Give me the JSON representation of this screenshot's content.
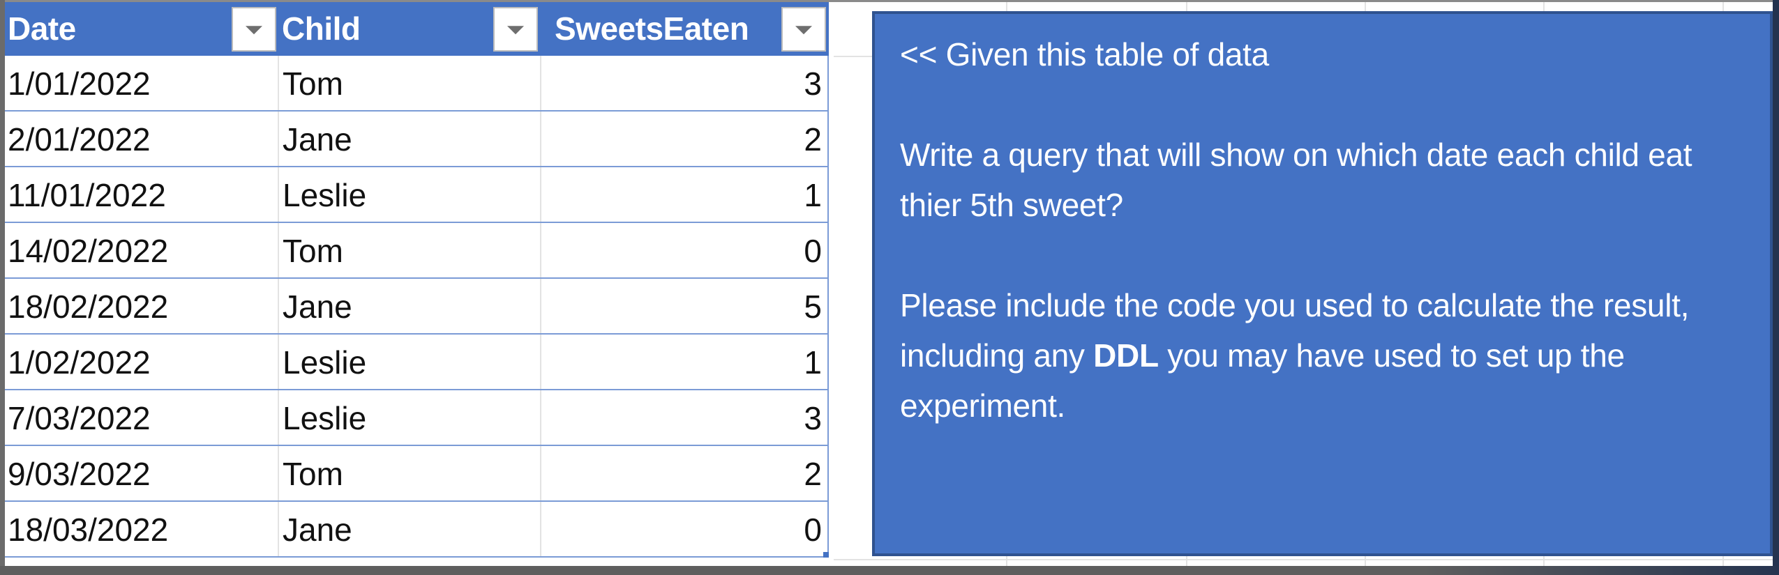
{
  "table": {
    "columns": [
      {
        "label": "Date",
        "filter_icon": "filter-dropdown-icon"
      },
      {
        "label": "Child",
        "filter_icon": "filter-dropdown-icon"
      },
      {
        "label": "SweetsEaten",
        "filter_icon": "filter-dropdown-icon"
      }
    ],
    "rows": [
      {
        "date": "1/01/2022",
        "child": "Tom",
        "sweets": "3"
      },
      {
        "date": "2/01/2022",
        "child": "Jane",
        "sweets": "2"
      },
      {
        "date": "11/01/2022",
        "child": "Leslie",
        "sweets": "1"
      },
      {
        "date": "14/02/2022",
        "child": "Tom",
        "sweets": "0"
      },
      {
        "date": "18/02/2022",
        "child": "Jane",
        "sweets": "5"
      },
      {
        "date": "1/02/2022",
        "child": "Leslie",
        "sweets": "1"
      },
      {
        "date": "7/03/2022",
        "child": "Leslie",
        "sweets": "3"
      },
      {
        "date": "9/03/2022",
        "child": "Tom",
        "sweets": "2"
      },
      {
        "date": "18/03/2022",
        "child": "Jane",
        "sweets": "0"
      }
    ]
  },
  "note": {
    "line1": "<< Given this table of data",
    "para2": "Write a query that will show on which date each child eat thier 5th sweet?",
    "para3_before": "Please include the code you used to calculate the result, including any ",
    "para3_bold": "DDL",
    "para3_after": " you may have used to set up the experiment."
  },
  "colors": {
    "header_bg": "#4472c4",
    "note_bg": "#4472c4",
    "note_border": "#2f528f",
    "row_border": "#7b9bd6"
  }
}
